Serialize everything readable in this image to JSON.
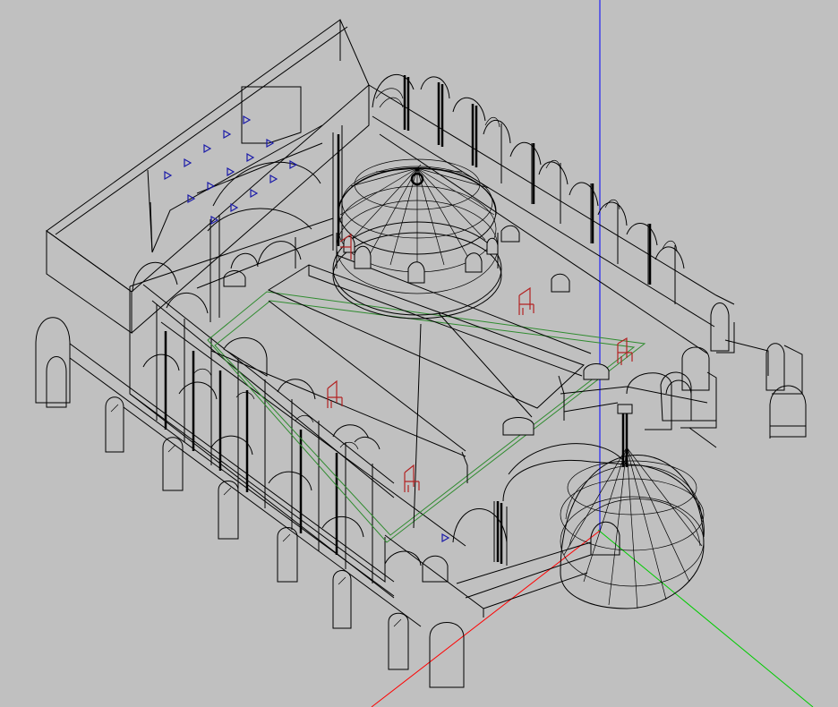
{
  "viewport": {
    "projection": "isometric-wireframe",
    "background_color": "#c0c0c0",
    "line_color": "#000000",
    "axes": [
      {
        "name": "x-axis",
        "color": "#ff0000"
      },
      {
        "name": "y-axis",
        "color": "#00cc00"
      },
      {
        "name": "z-axis",
        "color": "#0000ff"
      }
    ],
    "red_markers": 5,
    "blue_markers": 16
  }
}
